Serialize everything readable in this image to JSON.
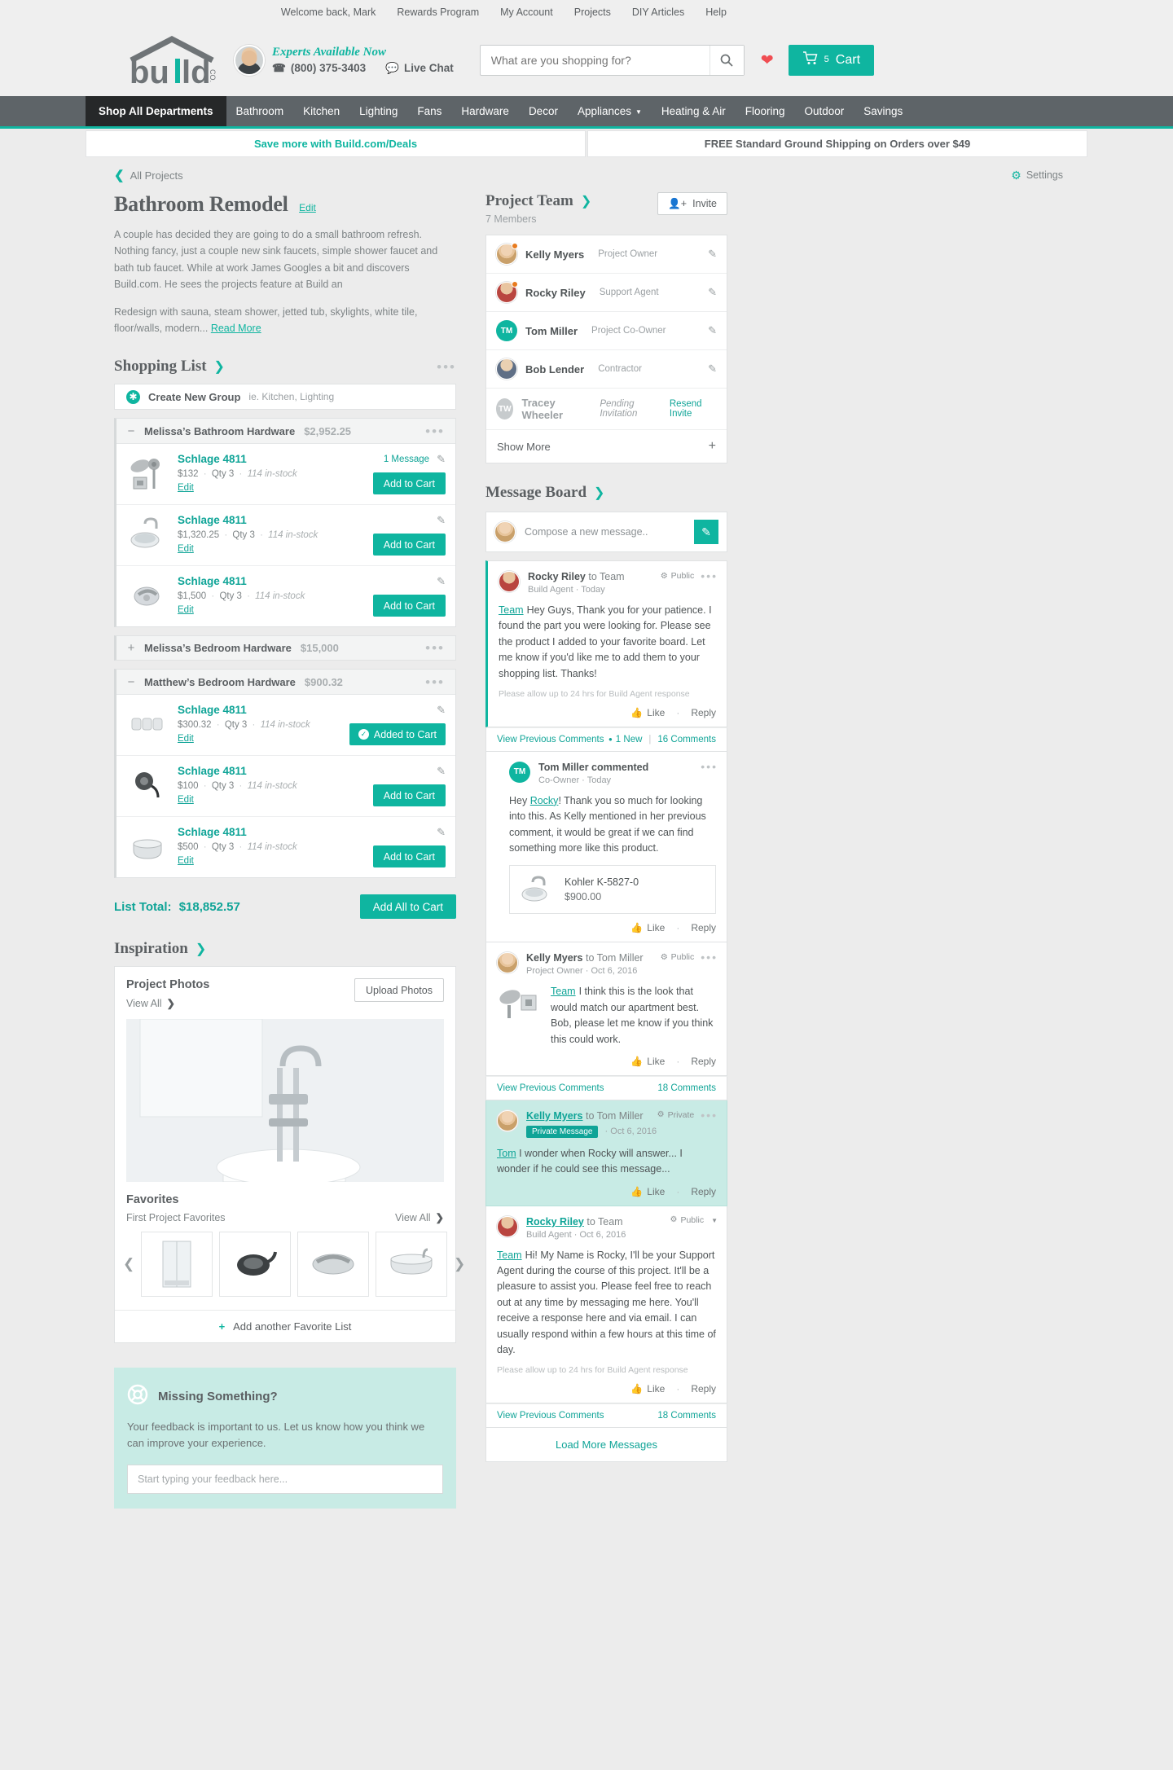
{
  "utility": {
    "links": [
      "Welcome back, Mark",
      "Rewards Program",
      "My Account",
      "Projects",
      "DIY Articles",
      "Help"
    ]
  },
  "header": {
    "expert_title": "Experts Available Now",
    "phone": "(800) 375-3403",
    "live_chat": "Live Chat",
    "search_placeholder": "What are you shopping for?",
    "cart_label": "Cart",
    "cart_count": "5"
  },
  "nav": {
    "all_departments": "Shop All Departments",
    "items": [
      "Bathroom",
      "Kitchen",
      "Lighting",
      "Fans",
      "Hardware",
      "Decor",
      "Appliances",
      "Heating & Air",
      "Flooring",
      "Outdoor",
      "Savings"
    ]
  },
  "promo": {
    "deals": "Save more with Build.com/Deals",
    "shipping": "FREE Standard Ground Shipping on Orders over $49"
  },
  "breadcrumb": {
    "label": "All Projects"
  },
  "settings": {
    "label": "Settings"
  },
  "project": {
    "title": "Bathroom Remodel",
    "edit": "Edit",
    "description": "A couple has decided they are going to do a small bathroom refresh. Nothing fancy, just a couple new sink faucets, simple shower faucet and bath tub faucet. While at work James Googles a bit and discovers Build.com. He sees the projects feature at Build an",
    "description2": "Redesign with sauna, steam shower, jetted tub, skylights, white tile, floor/walls, modern...",
    "read_more": "Read More"
  },
  "shopping_list": {
    "title": "Shopping List",
    "create_group_label": "Create New Group",
    "create_group_hint": "ie. Kitchen, Lighting",
    "list_total_label": "List Total:",
    "list_total_value": "$18,852.57",
    "add_all_label": "Add All to Cart",
    "groups": [
      {
        "name": "Melissa’s Bathroom Hardware",
        "total": "$2,952.25",
        "collapsed": false,
        "items": [
          {
            "name": "Schlage 4811",
            "price": "$132",
            "qty": "Qty 3",
            "stock": "114 in-stock",
            "edit": "Edit",
            "message": "1 Message",
            "button": "Add to Cart",
            "added": false,
            "thumb": "showerhead"
          },
          {
            "name": "Schlage 4811",
            "price": "$1,320.25",
            "qty": "Qty 3",
            "stock": "114 in-stock",
            "edit": "Edit",
            "message": "",
            "button": "Add to Cart",
            "added": false,
            "thumb": "vesselsink"
          },
          {
            "name": "Schlage 4811",
            "price": "$1,500",
            "qty": "Qty 3",
            "stock": "114 in-stock",
            "edit": "Edit",
            "message": "",
            "button": "Add to Cart",
            "added": false,
            "thumb": "lever"
          }
        ]
      },
      {
        "name": "Melissa’s Bedroom Hardware",
        "total": "$15,000",
        "collapsed": true,
        "items": []
      },
      {
        "name": "Matthew’s Bedroom Hardware",
        "total": "$900.32",
        "collapsed": false,
        "items": [
          {
            "name": "Schlage 4811",
            "price": "$300.32",
            "qty": "Qty 3",
            "stock": "114 in-stock",
            "edit": "Edit",
            "message": "",
            "button": "Added to Cart",
            "added": true,
            "thumb": "knobs"
          },
          {
            "name": "Schlage 4811",
            "price": "$100",
            "qty": "Qty 3",
            "stock": "114 in-stock",
            "edit": "Edit",
            "message": "",
            "button": "Add to Cart",
            "added": false,
            "thumb": "handshower"
          },
          {
            "name": "Schlage 4811",
            "price": "$500",
            "qty": "Qty 3",
            "stock": "114 in-stock",
            "edit": "Edit",
            "message": "",
            "button": "Add to Cart",
            "added": false,
            "thumb": "tub"
          }
        ]
      }
    ]
  },
  "inspiration": {
    "title": "Inspiration",
    "photos_title": "Project Photos",
    "view_all": "View All",
    "upload": "Upload Photos",
    "favorites_title": "Favorites",
    "favorites_sub": "First Project Favorites",
    "favorites_view_all": "View All",
    "favorites": [
      "shower-enclosure",
      "rain-showerhead",
      "lever-handle",
      "freestanding-tub"
    ],
    "add_favorite_list": "Add another Favorite List"
  },
  "feedback": {
    "title": "Missing Something?",
    "text": "Your feedback is important to us. Let us know how you think we can improve your experience.",
    "placeholder": "Start typing your feedback here..."
  },
  "team": {
    "title": "Project Team",
    "members_count": "7 Members",
    "invite": "Invite",
    "show_more": "Show More",
    "members": [
      {
        "name": "Kelly Myers",
        "role": "Project Owner",
        "avatar": "photo-female",
        "online": true,
        "action": "note"
      },
      {
        "name": "Rocky Riley",
        "role": "Support Agent",
        "avatar": "photo-male",
        "online": true,
        "action": "note"
      },
      {
        "name": "Tom Miller",
        "role": "Project Co-Owner",
        "avatar": "TM",
        "online": false,
        "action": "note"
      },
      {
        "name": "Bob Lender",
        "role": "Contractor",
        "avatar": "photo-male2",
        "online": false,
        "action": "note"
      },
      {
        "name": "Tracey Wheeler",
        "role": "Pending Invitation",
        "avatar": "TW",
        "online": false,
        "action": "Resend Invite"
      }
    ]
  },
  "message_board": {
    "title": "Message Board",
    "compose_placeholder": "Compose a new message..",
    "load_more": "Load More Messages",
    "posts": [
      {
        "author": "Rocky Riley",
        "to": "to Team",
        "role": "Build Agent",
        "date": "Today",
        "visibility": "Public",
        "tag": "Team",
        "body": "Hey Guys, Thank you for your patience. I found the part you were looking for. Please see the product I added to your favorite board. Let me know if you'd like me to add them to your shopping list. Thanks!",
        "note": "Please allow up to 24 hrs for Build Agent response",
        "like": "Like",
        "reply": "Reply",
        "comments_view": "View Previous Comments",
        "comments_new": "1 New",
        "comments_count": "16 Comments"
      },
      {
        "author": "Kelly Myers",
        "to": "to Tom Miller",
        "role": "Project Owner",
        "date": "Oct 6, 2016",
        "visibility": "Public",
        "tag": "Team",
        "body": "I think this is the look that would match our apartment best. Bob, please let me know if you think this could work.",
        "like": "Like",
        "reply": "Reply",
        "comments_view": "View Previous Comments",
        "comments_count": "18 Comments"
      },
      {
        "author": "Kelly Myers",
        "to": "to Tom Miller",
        "role": "Private Message",
        "date": "Oct 6, 2016",
        "visibility": "Private",
        "tag": "Tom",
        "body": "I wonder when Rocky will answer... I wonder if he could see this message...",
        "like": "Like",
        "reply": "Reply"
      },
      {
        "author": "Rocky Riley",
        "to": "to Team",
        "role": "Build Agent",
        "date": "Oct 6, 2016",
        "visibility": "Public",
        "tag": "Team",
        "body": "Hi! My Name is Rocky, I'll be your Support Agent during the course of this project. It'll be a pleasure to assist you. Please feel free to reach out at any time by messaging me here. You'll receive a response here and via email. I can usually respond within a few hours at this time of day.",
        "note": "Please allow up to 24 hrs for Build Agent response",
        "like": "Like",
        "reply": "Reply",
        "comments_view": "View Previous Comments",
        "comments_count": "18 Comments"
      }
    ],
    "comment": {
      "author": "Tom Miller commented",
      "role": "Co-Owner",
      "date": "Today",
      "body_pre": "Hey ",
      "tag": "Rocky",
      "body": "! Thank you so much for looking into this. As Kelly mentioned in her previous comment, it would be great if we can find something more like this product.",
      "product_name": "Kohler K-5827-0",
      "product_price": "$900.00",
      "like": "Like",
      "reply": "Reply"
    }
  },
  "colors": {
    "accent": "#0fb5a0",
    "dark": "#5b5f62",
    "nav": "#5e6468"
  }
}
